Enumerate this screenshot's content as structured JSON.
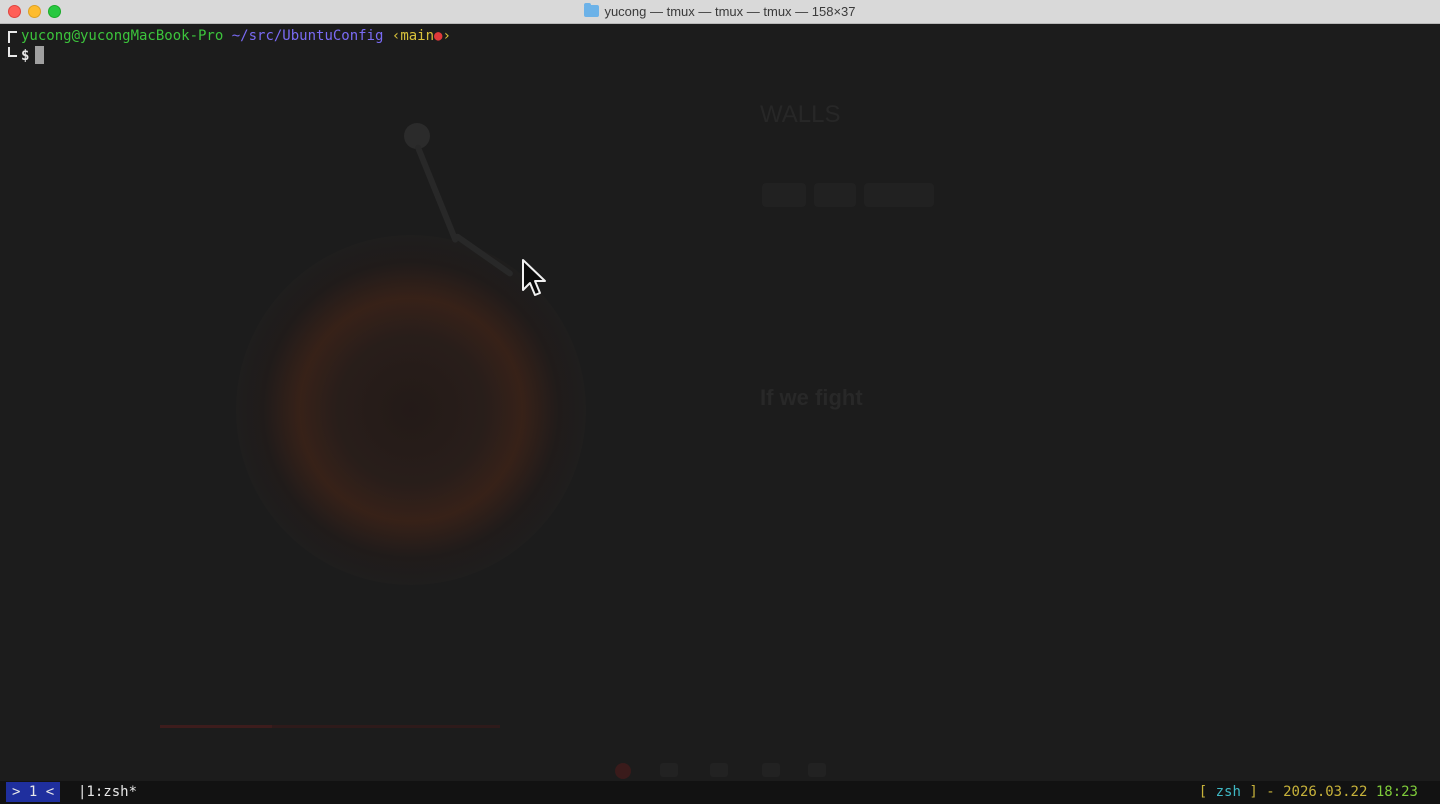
{
  "window": {
    "title": "yucong — tmux — tmux — tmux — 158×37",
    "title_icon": "folder-icon"
  },
  "prompt": {
    "user_host": "yucong@yucongMacBook-Pro",
    "path": "~/src/UbuntuConfig",
    "branch_open": "‹main",
    "branch_dot": "●",
    "branch_close": "›",
    "symbol": "$"
  },
  "background": {
    "song_title": "WALLS",
    "heading": "If we fight",
    "progress_fraction": 0.33
  },
  "statusbar": {
    "session": "> 1 <",
    "window_list": "|1:zsh*",
    "shell_open": "[",
    "shell_name": "zsh",
    "shell_close": "]",
    "separator": "-",
    "date": "2026.03.22",
    "time": "18:23"
  },
  "colors": {
    "user": "#3cc43c",
    "path": "#7a6bf5",
    "branch": "#d7c13b",
    "dirty_dot": "#e03a3a",
    "session_bg": "#1f2f9e"
  }
}
